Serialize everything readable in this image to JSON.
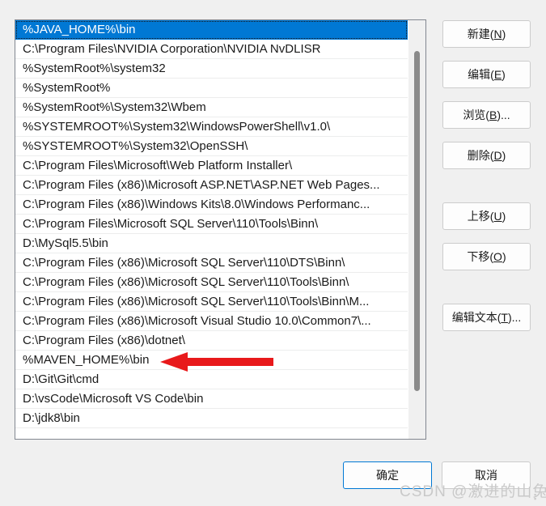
{
  "dialog": {
    "background_color": "#f0f0f0",
    "selection_color": "#0078d4",
    "focus_border_color": "#0078d4"
  },
  "path_list": {
    "selected_index": 0,
    "items": [
      "%JAVA_HOME%\\bin",
      "C:\\Program Files\\NVIDIA Corporation\\NVIDIA NvDLISR",
      "%SystemRoot%\\system32",
      "%SystemRoot%",
      "%SystemRoot%\\System32\\Wbem",
      "%SYSTEMROOT%\\System32\\WindowsPowerShell\\v1.0\\",
      "%SYSTEMROOT%\\System32\\OpenSSH\\",
      "C:\\Program Files\\Microsoft\\Web Platform Installer\\",
      "C:\\Program Files (x86)\\Microsoft ASP.NET\\ASP.NET Web Pages...",
      "C:\\Program Files (x86)\\Windows Kits\\8.0\\Windows Performanc...",
      "C:\\Program Files\\Microsoft SQL Server\\110\\Tools\\Binn\\",
      "D:\\MySql5.5\\bin",
      "C:\\Program Files (x86)\\Microsoft SQL Server\\110\\DTS\\Binn\\",
      "C:\\Program Files (x86)\\Microsoft SQL Server\\110\\Tools\\Binn\\",
      "C:\\Program Files (x86)\\Microsoft SQL Server\\110\\Tools\\Binn\\M...",
      "C:\\Program Files (x86)\\Microsoft Visual Studio 10.0\\Common7\\...",
      "C:\\Program Files (x86)\\dotnet\\",
      "%MAVEN_HOME%\\bin",
      "D:\\Git\\Git\\cmd",
      "D:\\vsCode\\Microsoft VS Code\\bin",
      "D:\\jdk8\\bin"
    ]
  },
  "side_buttons": [
    {
      "label": "新建(N)",
      "mnemonic": "N",
      "text_before": "新建(",
      "text_after": ")"
    },
    {
      "label": "编辑(E)",
      "mnemonic": "E",
      "text_before": "编辑(",
      "text_after": ")"
    },
    {
      "label": "浏览(B)...",
      "mnemonic": "B",
      "text_before": "浏览(",
      "text_after": ")..."
    },
    {
      "label": "删除(D)",
      "mnemonic": "D",
      "text_before": "删除(",
      "text_after": ")"
    },
    {
      "label": "上移(U)",
      "mnemonic": "U",
      "text_before": "上移(",
      "text_after": ")"
    },
    {
      "label": "下移(O)",
      "mnemonic": "O",
      "text_before": "下移(",
      "text_after": ")"
    },
    {
      "label": "编辑文本(T)...",
      "mnemonic": "T",
      "text_before": "编辑文本(",
      "text_after": ")..."
    }
  ],
  "bottom_buttons": {
    "ok": "确定",
    "cancel": "取消"
  },
  "annotation": {
    "type": "arrow-left",
    "color": "#e8191b",
    "points_at_item": "%MAVEN_HOME%\\bin"
  },
  "watermark": {
    "text": "CSDN @激进的山兔"
  }
}
